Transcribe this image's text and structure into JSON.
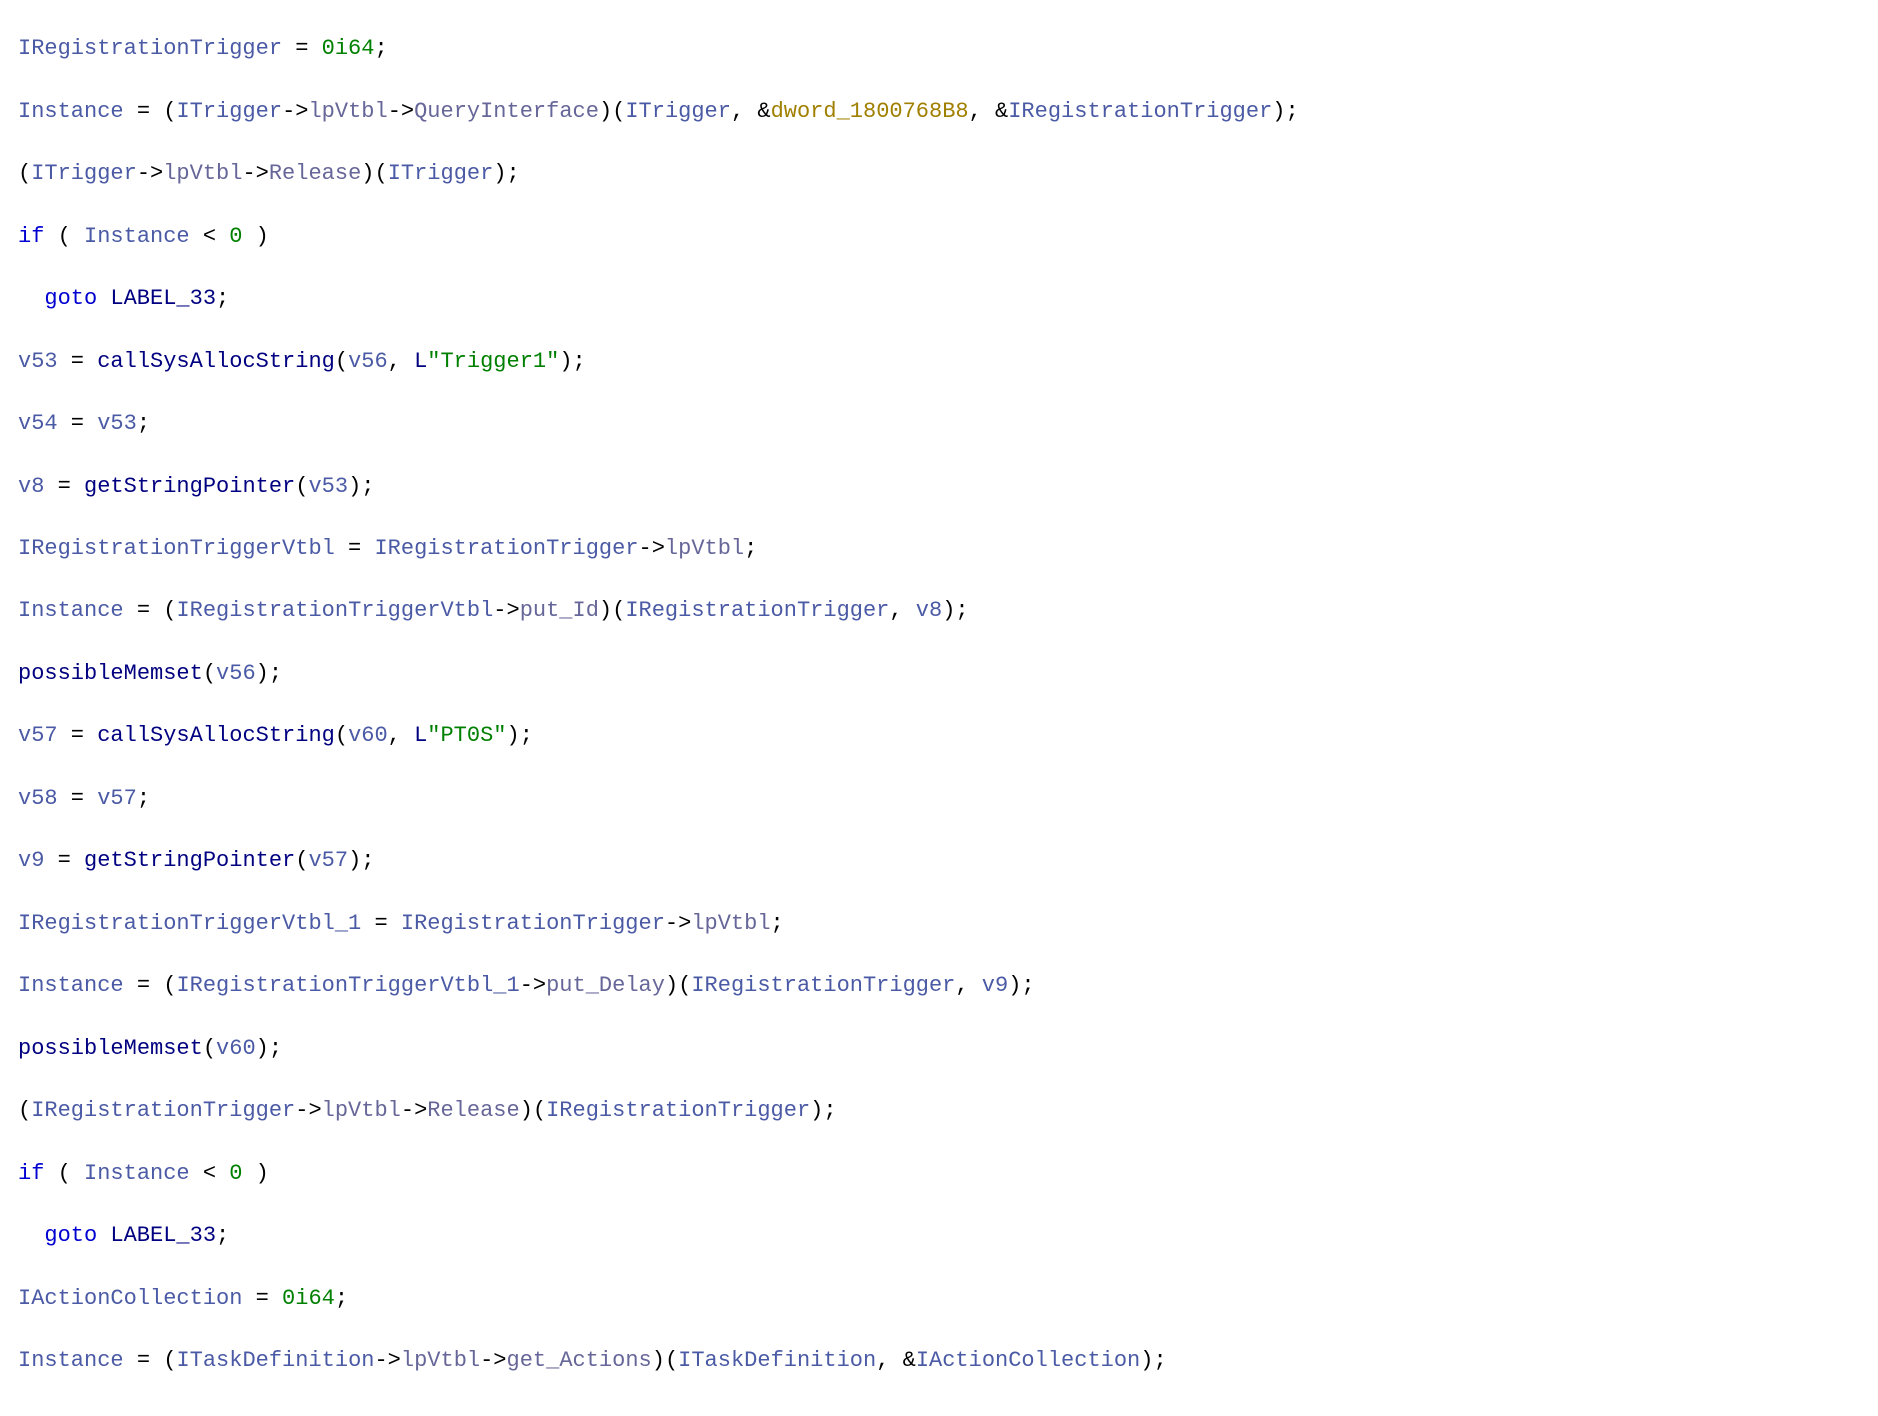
{
  "code": {
    "l1": {
      "a": "IRegistrationTrigger",
      "op1": " = ",
      "b": "0i64",
      "op2": ";"
    },
    "l2": {
      "a": "Instance",
      "op1": " = (",
      "b": "ITrigger",
      "op2": "->",
      "c": "lpVtbl",
      "op3": "->",
      "d": "QueryInterface",
      "op4": ")(",
      "e": "ITrigger",
      "op5": ", &",
      "f": "dword_1800768B8",
      "op6": ", &",
      "g": "IRegistrationTrigger",
      "op7": ");"
    },
    "l3": {
      "op1": "(",
      "a": "ITrigger",
      "op2": "->",
      "b": "lpVtbl",
      "op3": "->",
      "c": "Release",
      "op4": ")(",
      "d": "ITrigger",
      "op5": ");"
    },
    "l4": {
      "kw": "if",
      "op1": " ( ",
      "a": "Instance",
      "op2": " < ",
      "b": "0",
      "op3": " )"
    },
    "l5": {
      "kw": "goto",
      "sp": " ",
      "label": "LABEL_33",
      "op": ";"
    },
    "l6": {
      "a": "v53",
      "op1": " = ",
      "fn": "callSysAllocString",
      "op2": "(",
      "b": "v56",
      "op3": ", ",
      "L": "L",
      "str": "\"Trigger1\"",
      "op4": ");"
    },
    "l7": {
      "a": "v54",
      "op1": " = ",
      "b": "v53",
      "op2": ";"
    },
    "l8": {
      "a": "v8",
      "op1": " = ",
      "fn": "getStringPointer",
      "op2": "(",
      "b": "v53",
      "op3": ");"
    },
    "l9": {
      "a": "IRegistrationTriggerVtbl",
      "op1": " = ",
      "b": "IRegistrationTrigger",
      "op2": "->",
      "c": "lpVtbl",
      "op3": ";"
    },
    "l10": {
      "a": "Instance",
      "op1": " = (",
      "b": "IRegistrationTriggerVtbl",
      "op2": "->",
      "c": "put_Id",
      "op3": ")(",
      "d": "IRegistrationTrigger",
      "op4": ", ",
      "e": "v8",
      "op5": ");"
    },
    "l11": {
      "fn": "possibleMemset",
      "op1": "(",
      "a": "v56",
      "op2": ");"
    },
    "l12": {
      "a": "v57",
      "op1": " = ",
      "fn": "callSysAllocString",
      "op2": "(",
      "b": "v60",
      "op3": ", ",
      "L": "L",
      "str": "\"PT0S\"",
      "op4": ");"
    },
    "l13": {
      "a": "v58",
      "op1": " = ",
      "b": "v57",
      "op2": ";"
    },
    "l14": {
      "a": "v9",
      "op1": " = ",
      "fn": "getStringPointer",
      "op2": "(",
      "b": "v57",
      "op3": ");"
    },
    "l15": {
      "a": "IRegistrationTriggerVtbl_1",
      "op1": " = ",
      "b": "IRegistrationTrigger",
      "op2": "->",
      "c": "lpVtbl",
      "op3": ";"
    },
    "l16": {
      "a": "Instance",
      "op1": " = (",
      "b": "IRegistrationTriggerVtbl_1",
      "op2": "->",
      "c": "put_Delay",
      "op3": ")(",
      "d": "IRegistrationTrigger",
      "op4": ", ",
      "e": "v9",
      "op5": ");"
    },
    "l17": {
      "fn": "possibleMemset",
      "op1": "(",
      "a": "v60",
      "op2": ");"
    },
    "l18": {
      "op1": "(",
      "a": "IRegistrationTrigger",
      "op2": "->",
      "b": "lpVtbl",
      "op3": "->",
      "c": "Release",
      "op4": ")(",
      "d": "IRegistrationTrigger",
      "op5": ");"
    },
    "l19": {
      "kw": "if",
      "op1": " ( ",
      "a": "Instance",
      "op2": " < ",
      "b": "0",
      "op3": " )"
    },
    "l20": {
      "kw": "goto",
      "sp": " ",
      "label": "LABEL_33",
      "op": ";"
    },
    "l21": {
      "a": "IActionCollection",
      "op1": " = ",
      "b": "0i64",
      "op2": ";"
    },
    "l22": {
      "a": "Instance",
      "op1": " = (",
      "b": "ITaskDefinition",
      "op2": "->",
      "c": "lpVtbl",
      "op3": "->",
      "d": "get_Actions",
      "op4": ")(",
      "e": "ITaskDefinition",
      "op5": ", &",
      "f": "IActionCollection",
      "op6": ");"
    }
  }
}
